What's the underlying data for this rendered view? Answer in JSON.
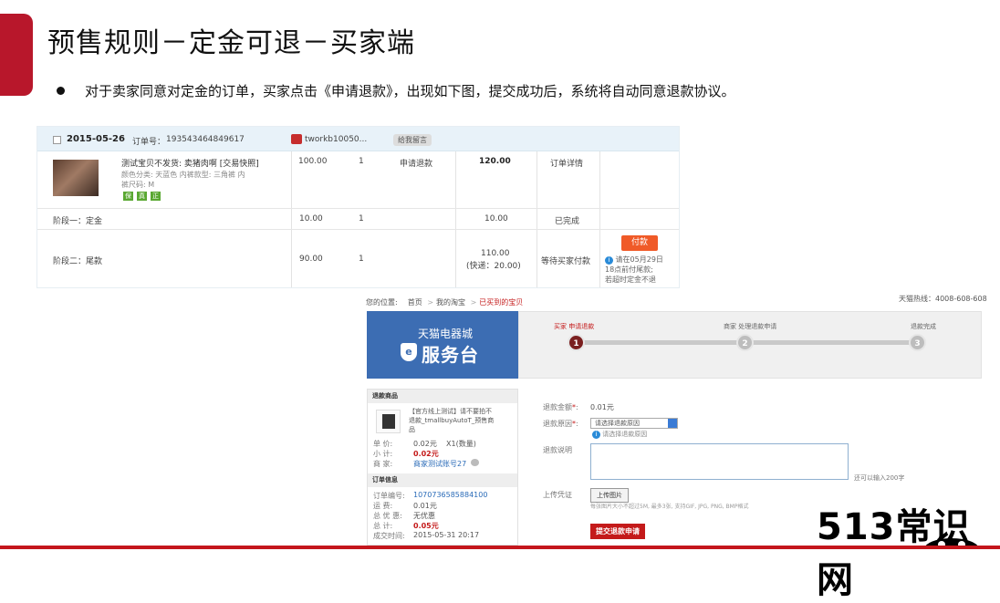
{
  "slide": {
    "title": "预售规则－定金可退－买家端",
    "bullet": "对于卖家同意对定金的订单，买家点击《申请退款》，出现如下图，提交成功后，系统将自动同意退款协议。",
    "watermark": "513常识网",
    "accent_color": "#b8172b"
  },
  "order": {
    "date": "2015-05-26",
    "order_no_label": "订单号：",
    "order_no": "193543464849617",
    "shop": "tworkb10050...",
    "leave_message": "给我留言",
    "item_title": "测试宝贝不发货:  卖猪肉啊 [交易快照]",
    "item_spec1": "颜色分类: 天蓝色  内裤款型: 三角裤  内",
    "item_spec2": "裤尺码: M",
    "tags": [
      "保",
      "真",
      "正"
    ],
    "price": "100.00",
    "qty": "1",
    "refund_link": "申请退款",
    "total": "120.00",
    "order_detail": "订单详情",
    "stage1": {
      "label": "阶段一：定金",
      "price": "10.00",
      "qty": "1",
      "total": "10.00",
      "status": "已完成"
    },
    "stage2": {
      "label": "阶段二：尾款",
      "price": "90.00",
      "qty": "1",
      "total": "110.00",
      "shipping": "(快递：20.00)",
      "status": "等待买家付款",
      "pay_button": "付款",
      "note1": "请在05月29日",
      "note2": "18点前付尾款;",
      "note3": "若超时定金不退"
    }
  },
  "refund": {
    "location_label": "您的位置:",
    "crumbs": [
      "首页",
      "我的淘宝",
      "已买到的宝贝"
    ],
    "hotline": "天猫热线：4008-608-608",
    "banner_top": "天猫电器城",
    "banner_main": "服务台",
    "steps": [
      {
        "num": "1",
        "label": "买家 申请退款"
      },
      {
        "num": "2",
        "label": "商家 处理退款申请"
      },
      {
        "num": "3",
        "label": "退款完成"
      }
    ],
    "goods_title": "退款商品",
    "goods_desc1": "【官方线上测试】请不要拍不",
    "goods_desc2": "退款_tmallbuyAutoT_预售商",
    "goods_desc3": "品",
    "unit_price_label": "单      价:",
    "unit_price": "0.02元",
    "qty_label": "X1(数量)",
    "subtotal_label": "小      计:",
    "subtotal": "0.02元",
    "seller_label": "商      家:",
    "seller": "商家测试账号27",
    "order_info_title": "订单信息",
    "order_no_label": "订单编号:",
    "order_no": "1070736585884100",
    "shipping_label": "运      费:",
    "shipping": "0.01元",
    "discount_label": "总 优 惠:",
    "discount": "无优惠",
    "total_label": "总      计:",
    "total": "0.05元",
    "time_label": "成交时间:",
    "time": "2015-05-31 20:17",
    "amount_label": "退款金额",
    "amount": "0.01元",
    "reason_label": "退款原因",
    "reason_placeholder": "请选择退款原因",
    "reason_hint": "请选择退款原因",
    "desc_label": "退款说明",
    "char_hint": "还可以输入200字",
    "upload_label": "上传凭证",
    "upload_button": "上传图片",
    "upload_hint": "每张图片大小不超过5M, 最多3张, 支持GIF, JPG, PNG, BMP格式",
    "submit": "提交退款申请",
    "required": "*"
  }
}
